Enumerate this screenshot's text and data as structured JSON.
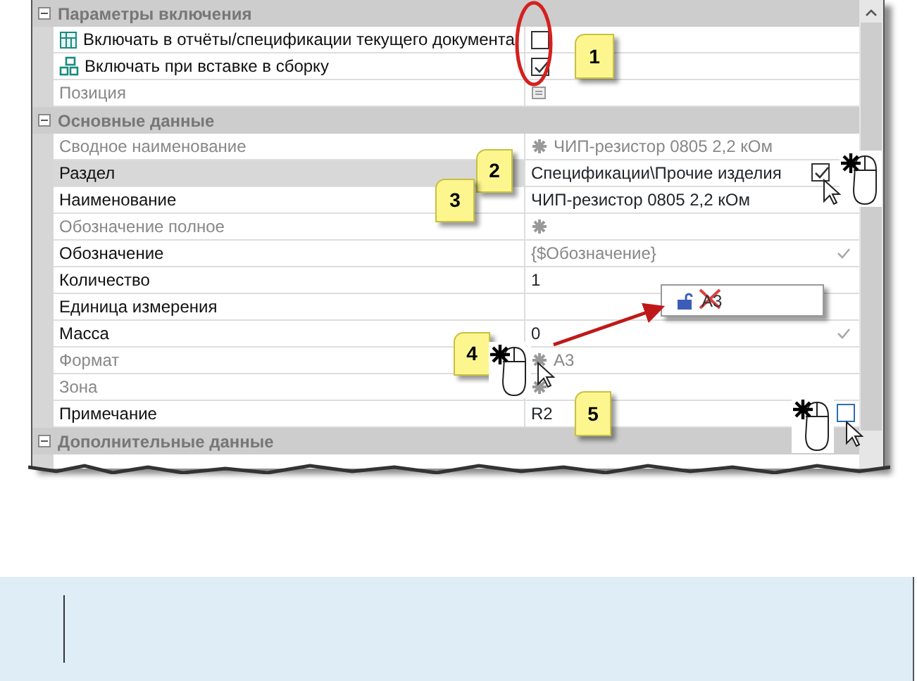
{
  "groups": [
    {
      "title": "Параметры включения",
      "expanded": true,
      "rows": [
        {
          "label": "Включать в отчёты/спецификации текущего документа",
          "dimmed": false,
          "selected": false,
          "kind": "checkbox",
          "checked": false
        },
        {
          "label": "Включать при вставке в сборку",
          "dimmed": false,
          "selected": false,
          "kind": "checkbox",
          "checked": true
        },
        {
          "label": "Позиция",
          "dimmed": true,
          "selected": false,
          "kind": "list"
        }
      ]
    },
    {
      "title": "Основные данные",
      "expanded": true,
      "rows": [
        {
          "label": "Сводное наименование",
          "dimmed": true,
          "selected": false,
          "kind": "text",
          "asterisk": true,
          "value": "ЧИП-резистор 0805 2,2 кОм",
          "value_dimmed": true
        },
        {
          "label": "Раздел",
          "dimmed": false,
          "selected": true,
          "kind": "text",
          "value": "Спецификации\\Прочие изделия",
          "value_dimmed": false
        },
        {
          "label": "Наименование",
          "dimmed": false,
          "selected": false,
          "kind": "text",
          "value": "ЧИП-резистор 0805 2,2 кОм",
          "value_dimmed": false
        },
        {
          "label": "Обозначение полное",
          "dimmed": true,
          "selected": false,
          "kind": "text",
          "asterisk": true
        },
        {
          "label": "Обозначение",
          "dimmed": false,
          "selected": false,
          "kind": "text",
          "value": "{$Обозначение}",
          "value_dimmed": true,
          "tick": true
        },
        {
          "label": "Количество",
          "dimmed": false,
          "selected": false,
          "kind": "text",
          "value": "1",
          "value_dimmed": false
        },
        {
          "label": "Единица измерения",
          "dimmed": false,
          "selected": false,
          "kind": "text"
        },
        {
          "label": "Масса",
          "dimmed": false,
          "selected": false,
          "kind": "text",
          "value": "0",
          "value_dimmed": false,
          "tick": true
        },
        {
          "label": "Формат",
          "dimmed": true,
          "selected": false,
          "kind": "text",
          "asterisk": true,
          "value": "А3",
          "value_dimmed": true
        },
        {
          "label": "Зона",
          "dimmed": true,
          "selected": false,
          "kind": "text",
          "asterisk": true
        },
        {
          "label": "Примечание",
          "dimmed": false,
          "selected": false,
          "kind": "text",
          "value": "R2",
          "value_dimmed": false
        }
      ]
    },
    {
      "title": "Дополнительные данные",
      "expanded": true
    }
  ],
  "annotations": {
    "callouts": [
      {
        "label": "1"
      },
      {
        "label": "2"
      },
      {
        "label": "3"
      },
      {
        "label": "4"
      },
      {
        "label": "5"
      }
    ],
    "overlay_checkboxes": [
      {
        "checked": true
      },
      {
        "checked": false
      }
    ],
    "popup": {
      "text": "А3",
      "struck": true
    }
  }
}
